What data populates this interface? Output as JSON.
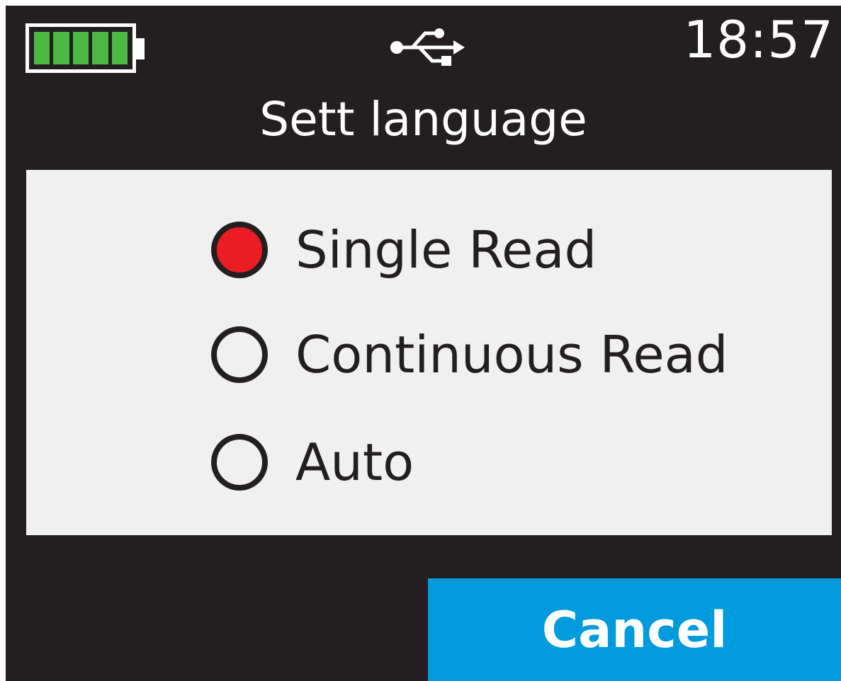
{
  "status_bar": {
    "battery_level_fraction": 1.0,
    "battery_color": "#4cb944",
    "usb_icon": "usb-icon",
    "time": "18:57"
  },
  "title": "Sett language",
  "options": [
    {
      "label": "Single Read",
      "selected": true
    },
    {
      "label": "Continuous Read",
      "selected": false
    },
    {
      "label": "Auto",
      "selected": false
    }
  ],
  "colors": {
    "background": "#231f20",
    "panel": "#f0f0f0",
    "selected_radio": "#ec1c24",
    "cancel_button": "#009bdc"
  },
  "cancel_label": "Cancel"
}
